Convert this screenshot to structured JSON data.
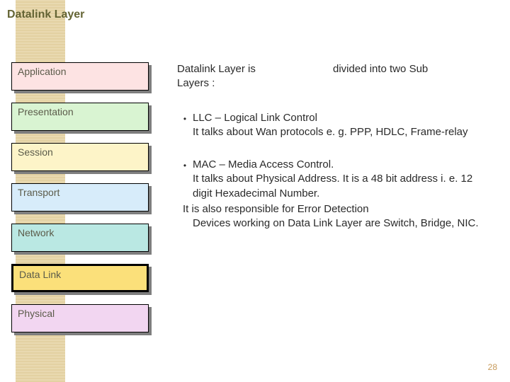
{
  "title": "Datalink Layer",
  "layers": [
    {
      "name": "Application",
      "color": "#fde3e3",
      "highlight": false
    },
    {
      "name": "Presentation",
      "color": "#d9f4d2",
      "highlight": false
    },
    {
      "name": "Session",
      "color": "#fdf4c8",
      "highlight": false
    },
    {
      "name": "Transport",
      "color": "#d7ecfa",
      "highlight": false
    },
    {
      "name": "Network",
      "color": "#bae8e3",
      "highlight": false
    },
    {
      "name": "Data Link",
      "color": "#fbe07a",
      "highlight": true
    },
    {
      "name": "Physical",
      "color": "#f2d6f1",
      "highlight": false
    }
  ],
  "intro": {
    "left": "Datalink Layer  is",
    "right": "divided into two Sub",
    "below": "Layers :"
  },
  "bullets": [
    {
      "head": "LLC – Logical Link Control",
      "lines": [
        "It talks about Wan protocols e. g. PPP, HDLC, Frame-relay"
      ]
    },
    {
      "head": "MAC – Media Access Control.",
      "lines": [
        "It talks about Physical Address. It is a 48 bit address i. e. 12 digit Hexadecimal Number.",
        "It is also responsible for Error Detection",
        "Devices working on Data Link Layer are Switch, Bridge, NIC."
      ]
    }
  ],
  "page_number": "28"
}
